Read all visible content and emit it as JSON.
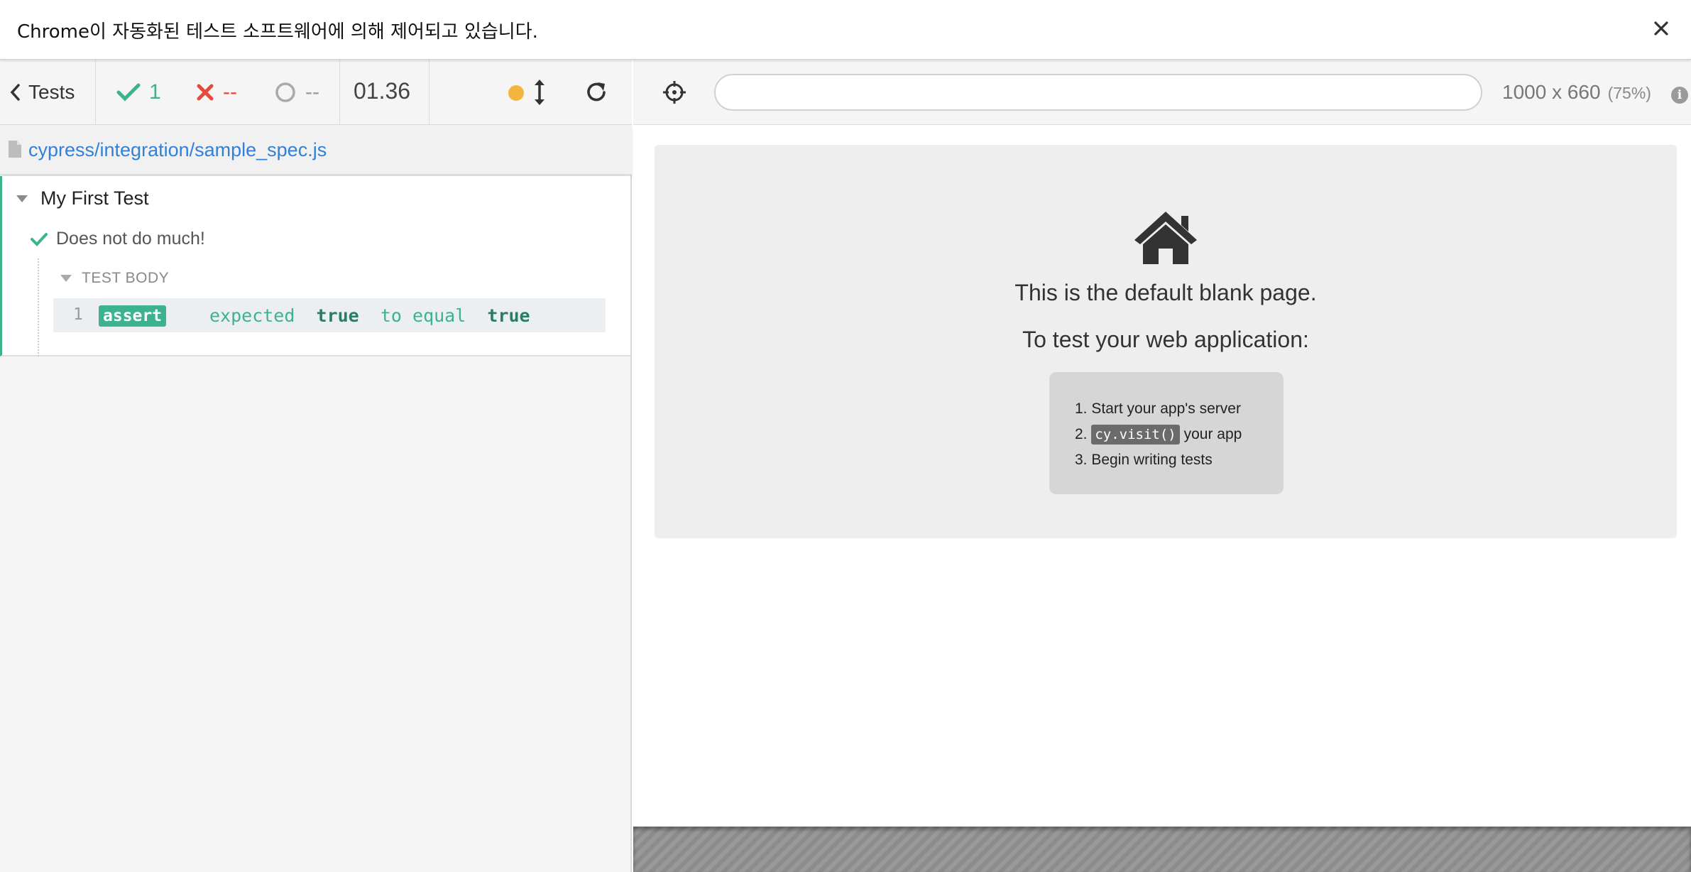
{
  "infobar": {
    "message": "Chrome이 자동화된 테스트 소프트웨어에 의해 제어되고 있습니다."
  },
  "reporter": {
    "tests_label": "Tests",
    "stats": {
      "passed": "1",
      "failed": "--",
      "pending": "--"
    },
    "duration": "01.36",
    "spec_path": "cypress/integration/sample_spec.js",
    "suite_title": "My First Test",
    "test_title": "Does not do much!",
    "test_body_label": "TEST BODY",
    "command": {
      "number": "1",
      "name": "assert",
      "message_parts": [
        "expected",
        "true",
        "to equal",
        "true"
      ]
    }
  },
  "aut": {
    "url_value": "",
    "viewport_size": "1000 x 660",
    "viewport_scale": "(75%)",
    "info_glyph": "i",
    "blank_page": {
      "heading": "This is the default blank page.",
      "subheading": "To test your web application:",
      "steps": [
        {
          "num": "1.",
          "text": "Start your app's server"
        },
        {
          "num": "2.",
          "code": "cy.visit()",
          "text": "your app"
        },
        {
          "num": "3.",
          "text": "Begin writing tests"
        }
      ]
    }
  },
  "colors": {
    "pass": "#3db28f",
    "fail": "#e34b3b",
    "link": "#3380d8",
    "running_dot": "#f4b53f"
  }
}
